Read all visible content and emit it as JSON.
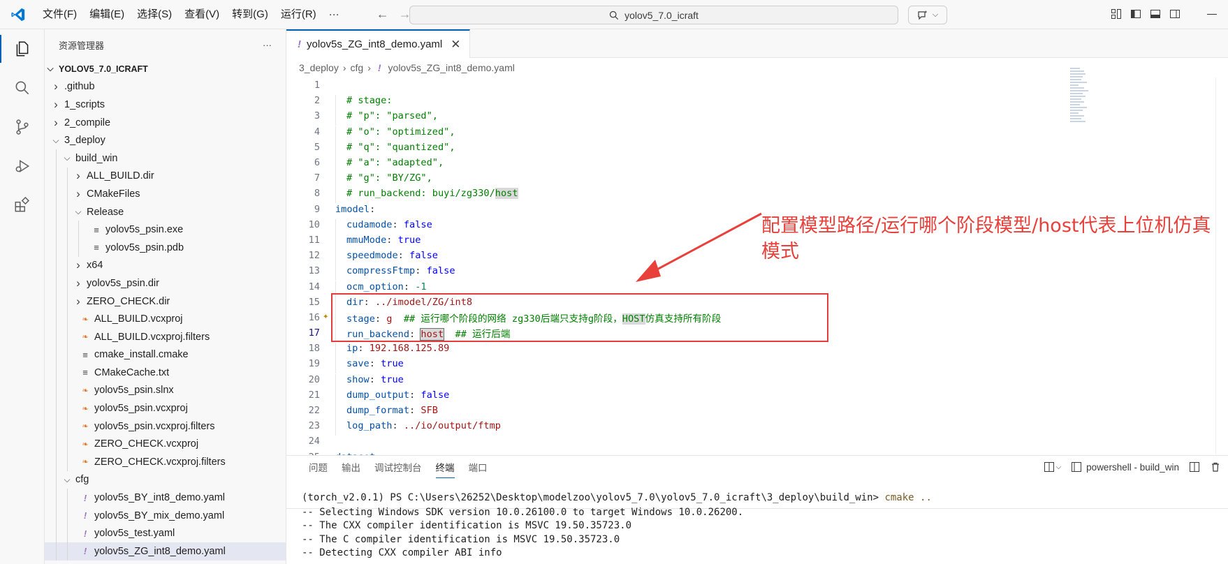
{
  "menu": [
    "文件(F)",
    "编辑(E)",
    "选择(S)",
    "查看(V)",
    "转到(G)",
    "运行(R)",
    "···"
  ],
  "search": {
    "text": "yolov5_7.0_icraft"
  },
  "sidebar": {
    "title": "资源管理器",
    "more": "···",
    "root": "YOLOV5_7.0_ICRAFT",
    "items": [
      {
        "label": ".github",
        "depth": 0,
        "kind": "folder",
        "open": false
      },
      {
        "label": "1_scripts",
        "depth": 0,
        "kind": "folder",
        "open": false
      },
      {
        "label": "2_compile",
        "depth": 0,
        "kind": "folder",
        "open": false
      },
      {
        "label": "3_deploy",
        "depth": 0,
        "kind": "folder",
        "open": true
      },
      {
        "label": "build_win",
        "depth": 1,
        "kind": "folder",
        "open": true
      },
      {
        "label": "ALL_BUILD.dir",
        "depth": 2,
        "kind": "folder",
        "open": false
      },
      {
        "label": "CMakeFiles",
        "depth": 2,
        "kind": "folder",
        "open": false
      },
      {
        "label": "Release",
        "depth": 2,
        "kind": "folder",
        "open": true
      },
      {
        "label": "yolov5s_psin.exe",
        "depth": 3,
        "kind": "lines"
      },
      {
        "label": "yolov5s_psin.pdb",
        "depth": 3,
        "kind": "lines"
      },
      {
        "label": "x64",
        "depth": 2,
        "kind": "folder",
        "open": false
      },
      {
        "label": "yolov5s_psin.dir",
        "depth": 2,
        "kind": "folder",
        "open": false
      },
      {
        "label": "ZERO_CHECK.dir",
        "depth": 2,
        "kind": "folder",
        "open": false
      },
      {
        "label": "ALL_BUILD.vcxproj",
        "depth": 2,
        "kind": "rss"
      },
      {
        "label": "ALL_BUILD.vcxproj.filters",
        "depth": 2,
        "kind": "rss"
      },
      {
        "label": "cmake_install.cmake",
        "depth": 2,
        "kind": "lines"
      },
      {
        "label": "CMakeCache.txt",
        "depth": 2,
        "kind": "lines"
      },
      {
        "label": "yolov5s_psin.slnx",
        "depth": 2,
        "kind": "rss"
      },
      {
        "label": "yolov5s_psin.vcxproj",
        "depth": 2,
        "kind": "rss"
      },
      {
        "label": "yolov5s_psin.vcxproj.filters",
        "depth": 2,
        "kind": "rss"
      },
      {
        "label": "ZERO_CHECK.vcxproj",
        "depth": 2,
        "kind": "rss"
      },
      {
        "label": "ZERO_CHECK.vcxproj.filters",
        "depth": 2,
        "kind": "rss"
      },
      {
        "label": "cfg",
        "depth": 1,
        "kind": "folder",
        "open": true
      },
      {
        "label": "yolov5s_BY_int8_demo.yaml",
        "depth": 2,
        "kind": "yaml"
      },
      {
        "label": "yolov5s_BY_mix_demo.yaml",
        "depth": 2,
        "kind": "yaml"
      },
      {
        "label": "yolov5s_test.yaml",
        "depth": 2,
        "kind": "yaml"
      },
      {
        "label": "yolov5s_ZG_int8_demo.yaml",
        "depth": 2,
        "kind": "yaml",
        "selected": true
      }
    ]
  },
  "editor": {
    "tab_label": "yolov5s_ZG_int8_demo.yaml",
    "breadcrumb": [
      "3_deploy",
      "cfg",
      "yolov5s_ZG_int8_demo.yaml"
    ],
    "lines": [
      {
        "n": "1",
        "parts": []
      },
      {
        "n": "2",
        "indent": 1,
        "parts": [
          [
            "c",
            "# stage:"
          ]
        ]
      },
      {
        "n": "3",
        "indent": 1,
        "parts": [
          [
            "c",
            "# \"p\": \"parsed\","
          ]
        ]
      },
      {
        "n": "4",
        "indent": 1,
        "parts": [
          [
            "c",
            "# \"o\": \"optimized\","
          ]
        ]
      },
      {
        "n": "5",
        "indent": 1,
        "parts": [
          [
            "c",
            "# \"q\": \"quantized\","
          ]
        ]
      },
      {
        "n": "6",
        "indent": 1,
        "parts": [
          [
            "c",
            "# \"a\": \"adapted\","
          ]
        ]
      },
      {
        "n": "7",
        "indent": 1,
        "parts": [
          [
            "c",
            "# \"g\": \"BY/ZG\","
          ]
        ]
      },
      {
        "n": "8",
        "indent": 1,
        "parts": [
          [
            "c",
            "# run_backend: buyi/zg330/"
          ],
          [
            "c hl",
            "host"
          ]
        ]
      },
      {
        "n": "9",
        "indent": 0,
        "parts": [
          [
            "k",
            "imodel"
          ],
          [
            "",
            ":"
          ]
        ]
      },
      {
        "n": "10",
        "indent": 1,
        "parts": [
          [
            "k",
            "cudamode"
          ],
          [
            "",
            ": "
          ],
          [
            "b",
            "false"
          ]
        ]
      },
      {
        "n": "11",
        "indent": 1,
        "parts": [
          [
            "k",
            "mmuMode"
          ],
          [
            "",
            ": "
          ],
          [
            "b",
            "true"
          ]
        ]
      },
      {
        "n": "12",
        "indent": 1,
        "parts": [
          [
            "k",
            "speedmode"
          ],
          [
            "",
            ": "
          ],
          [
            "b",
            "false"
          ]
        ]
      },
      {
        "n": "13",
        "indent": 1,
        "parts": [
          [
            "k",
            "compressFtmp"
          ],
          [
            "",
            ": "
          ],
          [
            "b",
            "false"
          ]
        ]
      },
      {
        "n": "14",
        "indent": 1,
        "parts": [
          [
            "k",
            "ocm_option"
          ],
          [
            "",
            ": "
          ],
          [
            "n",
            "-1"
          ]
        ]
      },
      {
        "n": "15",
        "indent": 1,
        "parts": [
          [
            "k",
            "dir"
          ],
          [
            "",
            ": "
          ],
          [
            "s",
            "../imodel/ZG/int8"
          ]
        ]
      },
      {
        "n": "16",
        "indent": 1,
        "sparkle": true,
        "parts": [
          [
            "k",
            "stage"
          ],
          [
            "",
            ": "
          ],
          [
            "s",
            "g"
          ],
          [
            "c",
            "  ## 运行哪个阶段的网络 zg330后端只支持g阶段，"
          ],
          [
            "c hl",
            "HOST"
          ],
          [
            "c",
            "仿真支持所有阶段"
          ]
        ]
      },
      {
        "n": "17",
        "indent": 1,
        "current": true,
        "parts": [
          [
            "k",
            "run_backend"
          ],
          [
            "",
            ": "
          ],
          [
            "s hlbox",
            "host"
          ],
          [
            "c",
            "  ## 运行后端"
          ]
        ]
      },
      {
        "n": "18",
        "indent": 1,
        "parts": [
          [
            "k",
            "ip"
          ],
          [
            "",
            ": "
          ],
          [
            "s",
            "192.168.125.89"
          ]
        ]
      },
      {
        "n": "19",
        "indent": 1,
        "parts": [
          [
            "k",
            "save"
          ],
          [
            "",
            ": "
          ],
          [
            "b",
            "true"
          ]
        ]
      },
      {
        "n": "20",
        "indent": 1,
        "parts": [
          [
            "k",
            "show"
          ],
          [
            "",
            ": "
          ],
          [
            "b",
            "true"
          ]
        ]
      },
      {
        "n": "21",
        "indent": 1,
        "parts": [
          [
            "k",
            "dump_output"
          ],
          [
            "",
            ": "
          ],
          [
            "b",
            "false"
          ]
        ]
      },
      {
        "n": "22",
        "indent": 1,
        "parts": [
          [
            "k",
            "dump_format"
          ],
          [
            "",
            ": "
          ],
          [
            "s",
            "SFB"
          ]
        ]
      },
      {
        "n": "23",
        "indent": 1,
        "parts": [
          [
            "k",
            "log_path"
          ],
          [
            "",
            ": "
          ],
          [
            "s",
            "../io/output/ftmp"
          ]
        ]
      },
      {
        "n": "24",
        "parts": []
      },
      {
        "n": "25",
        "indent": 0,
        "parts": [
          [
            "k",
            "dataset"
          ],
          [
            "",
            ":"
          ]
        ]
      }
    ]
  },
  "annotation": {
    "text": "配置模型路径/运行哪个阶段模型/host代表上位机仿真模式",
    "color": "#e8403a"
  },
  "panel": {
    "tabs": [
      "问题",
      "输出",
      "调试控制台",
      "终端",
      "端口"
    ],
    "active_tab": "终端",
    "terminal_name": "powershell - build_win",
    "prompt": "(torch_v2.0.1) PS C:\\Users\\26252\\Desktop\\modelzoo\\yolov5_7.0\\yolov5_7.0_icraft\\3_deploy\\build_win> ",
    "command": "cmake ..",
    "output": [
      "-- Selecting Windows SDK version 10.0.26100.0 to target Windows 10.0.26200.",
      "-- The CXX compiler identification is MSVC 19.50.35723.0",
      "-- The C compiler identification is MSVC 19.50.35723.0",
      "-- Detecting CXX compiler ABI info"
    ]
  },
  "colors": {
    "accent": "#005fb8",
    "annotation": "#e8403a",
    "yaml_icon": "#a074c4",
    "rss_icon": "#e37933"
  }
}
